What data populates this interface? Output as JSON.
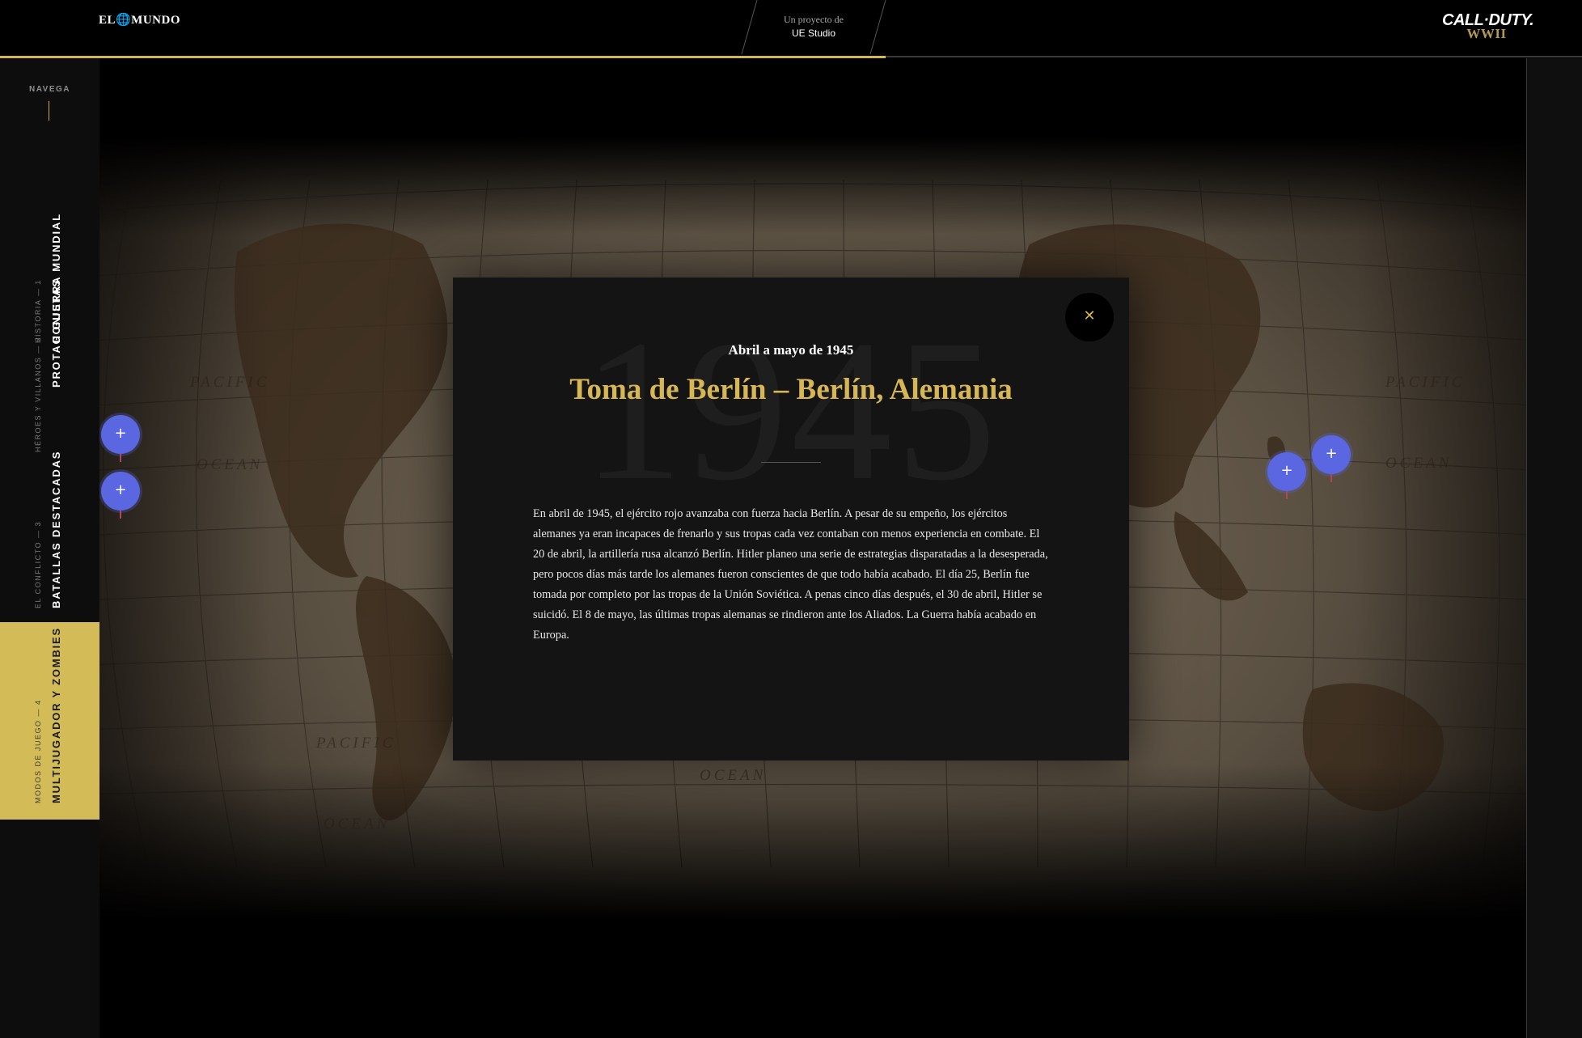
{
  "header": {
    "brand_logo": "EL🌐MUNDO",
    "project_label": "Un proyecto de",
    "project_studio": "UE Studio",
    "partner_logo_top": "CALL·DUTY.",
    "partner_logo_bottom": "WWII",
    "reading_progress": 0.56,
    "accent_color": "#d4b84e"
  },
  "sidebar": {
    "heading": "NAVEGA",
    "items": [
      {
        "subtitle": "HISTORIA — 1",
        "title": "II GUERRA MUNDIAL",
        "active": false
      },
      {
        "subtitle": "HÉROES Y VILLANOS — 2",
        "title": "PROTAGONISTAS",
        "active": false
      },
      {
        "subtitle": "EL CONFLICTO — 3",
        "title": "BATALLAS DESTACADAS",
        "active": false
      },
      {
        "subtitle": "MODOS DE JUEGO — 4",
        "title": "MULTIJUGADOR Y ZOMBIES",
        "active": true
      }
    ],
    "active_color": "#d3bc57"
  },
  "map": {
    "labels": {
      "pacific_nw": "PACIFIC",
      "ocean_nw": "OCEAN",
      "pacific_ne": "PACIFIC",
      "ocean_ne": "OCEAN",
      "pacific_sw": "PACIFIC",
      "ocean_sw": "OCEAN",
      "ocean_s": "OCEAN"
    },
    "hotspot_icon": "plus-icon",
    "hotspot_color": "#5b67e0"
  },
  "modal": {
    "background_year": "1945",
    "date": "Abril a mayo de 1945",
    "title": "Toma de Berlín – Berlín, Alemania",
    "body": "En abril de 1945, el ejército rojo avanzaba con fuerza hacia Berlín. A pesar de su empeño, los ejércitos alemanes ya eran incapaces de frenarlo y sus tropas cada vez contaban con menos experiencia en combate. El 20 de abril, la artillería rusa alcanzó Berlín. Hitler planeo una serie de estrategias disparatadas a la desesperada, pero pocos días más tarde los alemanes fueron conscientes de que todo había acabado. El día 25, Berlín fue tomada por completo por las tropas de la Unión Soviética. A penas cinco días después, el 30 de abril, Hitler se suicidó. El 8 de mayo, las últimas tropas alemanas se rindieron ante los Aliados. La Guerra había acabado en Europa.",
    "close_icon": "close-icon",
    "title_color": "#d7b655"
  }
}
